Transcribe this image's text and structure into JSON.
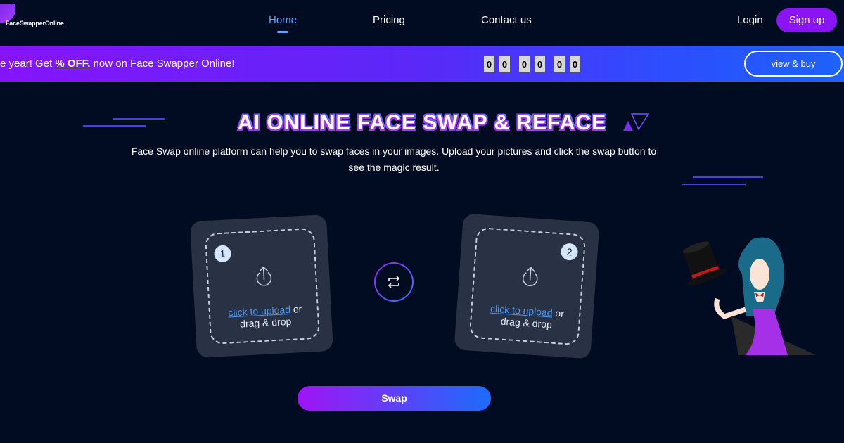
{
  "nav": {
    "logo": "FaceSwapperOnline",
    "links": [
      {
        "label": "Home",
        "active": true
      },
      {
        "label": "Pricing"
      },
      {
        "label": "Contact us"
      }
    ],
    "login": "Login",
    "signup": "Sign up"
  },
  "banner": {
    "msg_start": "e year! Get ",
    "discount": "% OFF.",
    "msg_end": " now on Face Swapper Online!",
    "countdown": [
      "0",
      "0",
      "0",
      "0",
      "0",
      "0"
    ],
    "cta": "view & buy"
  },
  "hero": {
    "title": "AI ONLINE FACE SWAP & REFACE",
    "subtitle": "Face Swap online platform can help you to swap faces in your images. Upload your pictures and click the swap button to see the magic result."
  },
  "upload": [
    {
      "number": "1",
      "link": "click to upload",
      "or": " or",
      "drag": "drag & drop"
    },
    {
      "number": "2",
      "link": "click to upload",
      "or": " or",
      "drag": "drag & drop"
    }
  ],
  "swap_label": "Swap",
  "colors": {
    "background": "#010c22",
    "accent_purple": "#8a14f5",
    "accent_blue": "#1d62fb",
    "active_link": "#5aa3ff",
    "card": "#283244"
  }
}
